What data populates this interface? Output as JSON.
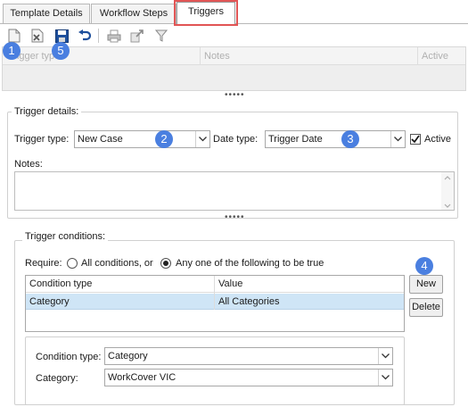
{
  "tabs": [
    {
      "label": "Template Details"
    },
    {
      "label": "Workflow Steps"
    },
    {
      "label": "Triggers",
      "active": true
    }
  ],
  "toolbar": {
    "icons": [
      "new-document-icon",
      "delete-document-icon",
      "save-icon",
      "undo-icon",
      "print-icon",
      "export-icon",
      "filter-icon"
    ]
  },
  "grid": {
    "columns": [
      "Trigger type",
      "Notes",
      "Active"
    ]
  },
  "splitter_text": "•••••",
  "trigger_details": {
    "title": "Trigger details:",
    "trigger_type_label": "Trigger type:",
    "trigger_type_value": "New Case",
    "date_type_label": "Date type:",
    "date_type_value": "Trigger Date",
    "active_label": "Active",
    "active_checked": true,
    "notes_label": "Notes:",
    "notes_value": ""
  },
  "trigger_conditions": {
    "title": "Trigger conditions:",
    "require_label": "Require:",
    "option_all": "All conditions, or",
    "option_any": "Any one of the following to be true",
    "selected": "any",
    "columns": [
      "Condition type",
      "Value"
    ],
    "rows": [
      {
        "condition_type": "Category",
        "value": "All Categories"
      }
    ],
    "new_button": "New",
    "delete_button": "Delete",
    "condition_type_label": "Condition type:",
    "condition_type_value": "Category",
    "category_label": "Category:",
    "category_value": "WorkCover VIC"
  },
  "annotations": [
    "1",
    "2",
    "3",
    "4",
    "5"
  ],
  "colors": {
    "highlight": "#e15555",
    "badge": "#4a7fe0",
    "selected_row": "#cfe5f6"
  }
}
